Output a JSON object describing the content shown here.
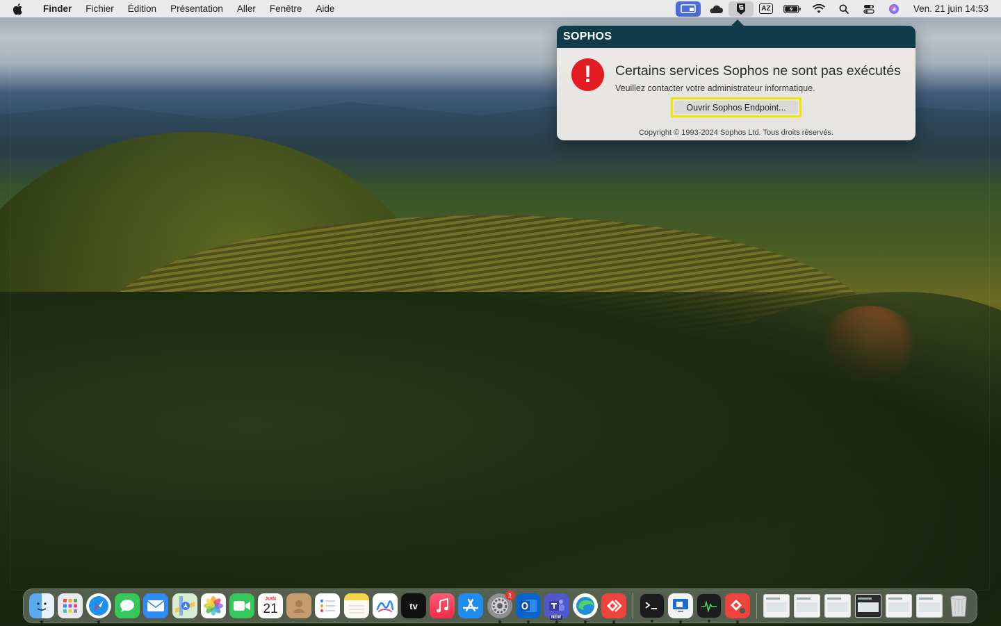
{
  "menubar": {
    "apple_icon": "apple-icon",
    "app_name": "Finder",
    "items": [
      "Fichier",
      "Édition",
      "Présentation",
      "Aller",
      "Fenêtre",
      "Aide"
    ],
    "status_icons": [
      "screen-mirroring-icon",
      "cloud-icon",
      "sophos-icon",
      "keyboard-input-icon",
      "battery-icon",
      "wifi-icon",
      "search-icon",
      "control-center-icon",
      "siri-icon"
    ],
    "input_label": "AZ",
    "clock": "Ven. 21 juin  14:53"
  },
  "popover": {
    "logo": "SOPHOS",
    "title": "Certains services Sophos ne sont pas exécutés",
    "subtitle": "Veuillez contacter votre administrateur informatique.",
    "button": "Ouvrir Sophos Endpoint...",
    "copyright": "Copyright © 1993-2024 Sophos Ltd. Tous droits réservés.",
    "colors": {
      "header": "#0f3b4a",
      "alert": "#e31b23",
      "highlight": "#f3e300"
    }
  },
  "dock": {
    "calendar_month": "JUIN",
    "calendar_day": "21",
    "settings_badge": "1",
    "teams_tag": "NEW",
    "tv_label": "tv"
  }
}
